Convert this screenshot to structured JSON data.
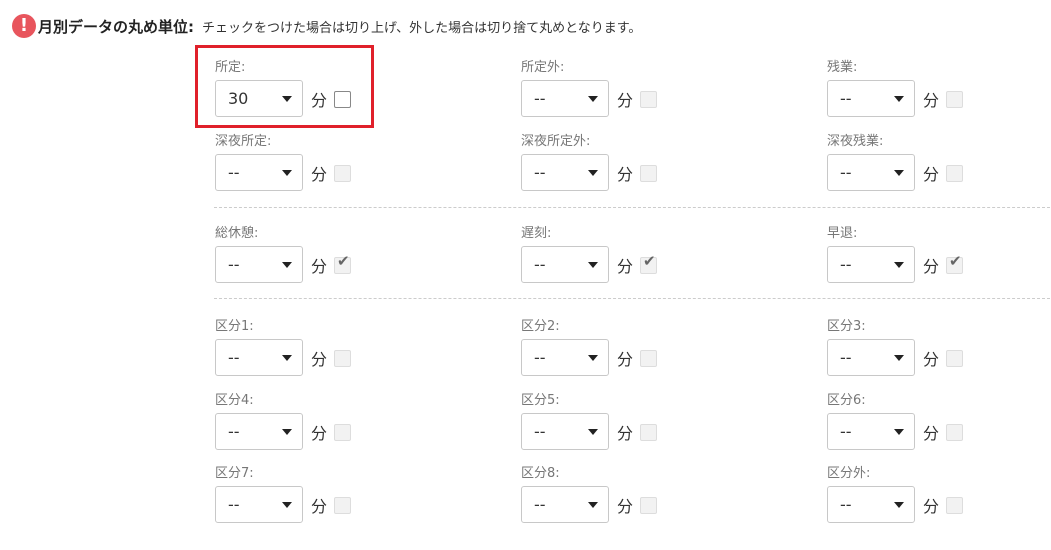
{
  "header": {
    "title": "月別データの丸め単位:",
    "description": "チェックをつけた場合は切り上げ、外した場合は切り捨て丸めとなります。"
  },
  "unit_label": "分",
  "fields": [
    {
      "label": "所定:",
      "value": "30",
      "checked": false,
      "enabled": true
    },
    {
      "label": "所定外:",
      "value": "--",
      "checked": false,
      "enabled": false
    },
    {
      "label": "残業:",
      "value": "--",
      "checked": false,
      "enabled": false
    },
    {
      "label": "深夜所定:",
      "value": "--",
      "checked": false,
      "enabled": false
    },
    {
      "label": "深夜所定外:",
      "value": "--",
      "checked": false,
      "enabled": false
    },
    {
      "label": "深夜残業:",
      "value": "--",
      "checked": false,
      "enabled": false
    },
    {
      "label": "総休憩:",
      "value": "--",
      "checked": true,
      "enabled": false
    },
    {
      "label": "遅刻:",
      "value": "--",
      "checked": true,
      "enabled": false
    },
    {
      "label": "早退:",
      "value": "--",
      "checked": true,
      "enabled": false
    },
    {
      "label": "区分1:",
      "value": "--",
      "checked": false,
      "enabled": false
    },
    {
      "label": "区分2:",
      "value": "--",
      "checked": false,
      "enabled": false
    },
    {
      "label": "区分3:",
      "value": "--",
      "checked": false,
      "enabled": false
    },
    {
      "label": "区分4:",
      "value": "--",
      "checked": false,
      "enabled": false
    },
    {
      "label": "区分5:",
      "value": "--",
      "checked": false,
      "enabled": false
    },
    {
      "label": "区分6:",
      "value": "--",
      "checked": false,
      "enabled": false
    },
    {
      "label": "区分7:",
      "value": "--",
      "checked": false,
      "enabled": false
    },
    {
      "label": "区分8:",
      "value": "--",
      "checked": false,
      "enabled": false
    },
    {
      "label": "区分外:",
      "value": "--",
      "checked": false,
      "enabled": false
    }
  ],
  "colors": {
    "warning_icon": "#e8555d",
    "highlight_border": "#e0202a"
  }
}
